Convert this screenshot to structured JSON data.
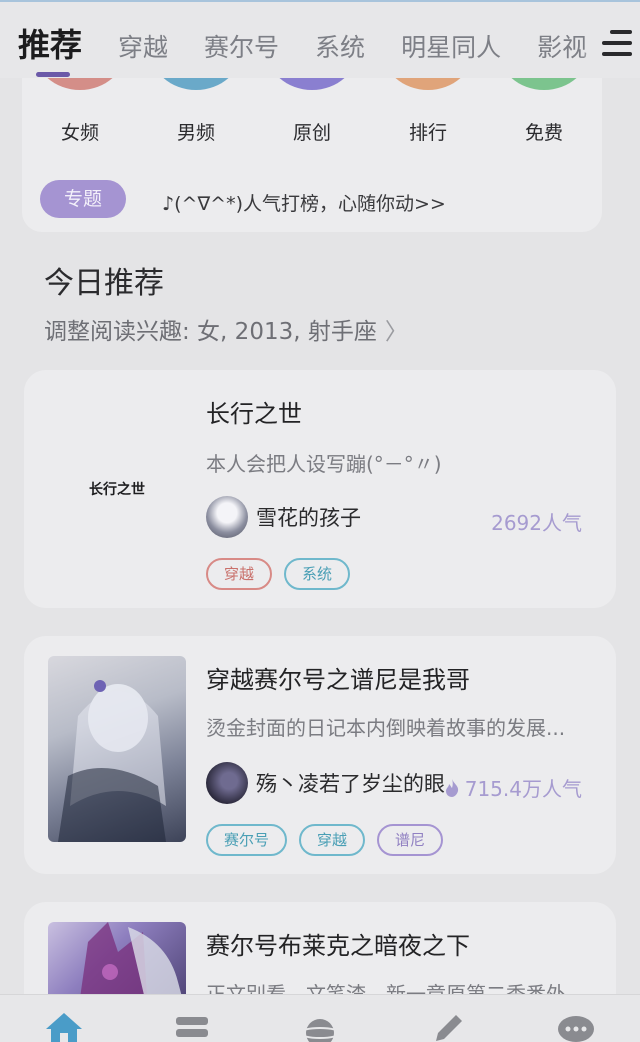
{
  "top_tabs": [
    "推荐",
    "穿越",
    "赛尔号",
    "系统",
    "明星同人",
    "影视"
  ],
  "categories": [
    {
      "label": "女频",
      "color": "#d48e88"
    },
    {
      "label": "男频",
      "color": "#6aa9c9"
    },
    {
      "label": "原创",
      "color": "#8a7fd0"
    },
    {
      "label": "排行",
      "color": "#e0a47a"
    },
    {
      "label": "免费",
      "color": "#7cc48e"
    }
  ],
  "topic": {
    "badge": "专题",
    "text": "♪(^∇^*)人气打榜，心随你动>>"
  },
  "recommend": {
    "title": "今日推荐",
    "subtitle": "调整阅读兴趣: 女, 2013, 射手座",
    "chevron": "〉"
  },
  "books": [
    {
      "title": "长行之世",
      "cover_text": "长行之世",
      "desc": "本人会把人设写蹦(°－°〃)",
      "author": "雪花的孩子",
      "popularity": "2692人气",
      "tags": [
        {
          "label": "穿越",
          "color": "red"
        },
        {
          "label": "系统",
          "color": "blue"
        }
      ]
    },
    {
      "title": "穿越赛尔号之谱尼是我哥",
      "desc": "烫金封面的日记本内倒映着故事的发展...",
      "author": "殇丶凌若了岁尘的眼",
      "popularity": "715.4万人气",
      "tags": [
        {
          "label": "赛尔号",
          "color": "blue"
        },
        {
          "label": "穿越",
          "color": "blue"
        },
        {
          "label": "谱尼",
          "color": "purple"
        }
      ]
    },
    {
      "title": "赛尔号布莱克之暗夜之下",
      "desc": "正文别看，文笔渣，新一章原第二季番外"
    }
  ],
  "bottom_nav": [
    {
      "icon": "home-icon",
      "color": "#4a9cc8"
    },
    {
      "icon": "bookshelf-icon",
      "color": "#8a8b90"
    },
    {
      "icon": "planet-icon",
      "color": "#8a8b90"
    },
    {
      "icon": "pen-icon",
      "color": "#8a8b90"
    },
    {
      "icon": "chat-icon",
      "color": "#8a8b90"
    }
  ]
}
